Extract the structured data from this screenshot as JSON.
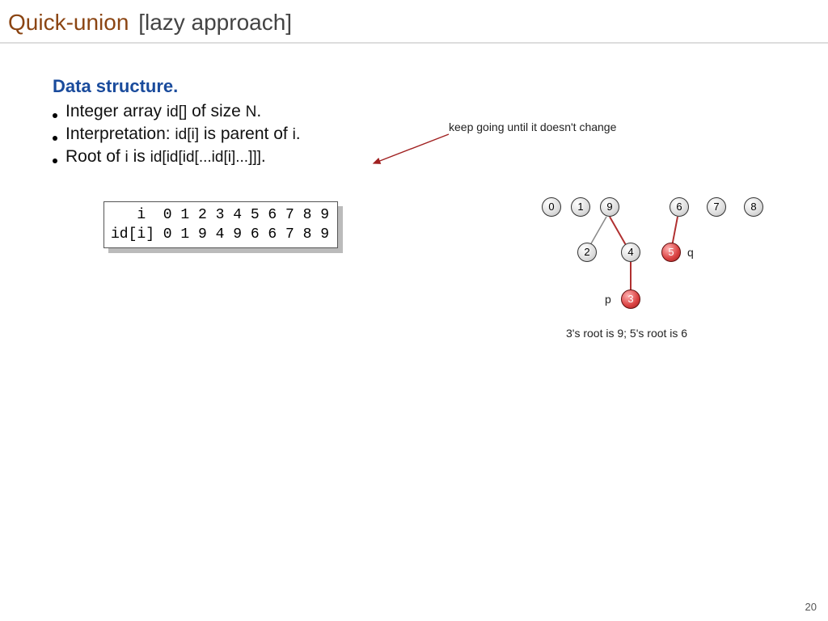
{
  "title": {
    "main": "Quick-union",
    "sub": "[lazy approach]"
  },
  "heading": "Data structure.",
  "bullets": [
    {
      "pre": "Integer array ",
      "code": "id[]",
      "mid": " of size ",
      "code2": "N",
      "post": "."
    },
    {
      "pre": "Interpretation:  ",
      "code": "id[i]",
      "mid": " is parent of ",
      "code2": "i",
      "post": "."
    },
    {
      "pre": "Root of ",
      "code": "i",
      "mid": " is ",
      "code2": "id[id[id[...id[i]...]]]",
      "post": "."
    }
  ],
  "keep_note": "keep going until it doesn't change",
  "array": {
    "row1": "   i  0 1 2 3 4 5 6 7 8 9",
    "row2": "id[i] 0 1 9 4 9 6 6 7 8 9"
  },
  "nodes": {
    "n0": "0",
    "n1": "1",
    "n2": "2",
    "n3": "3",
    "n4": "4",
    "n5": "5",
    "n6": "6",
    "n7": "7",
    "n8": "8",
    "n9": "9"
  },
  "labels": {
    "p": "p",
    "q": "q"
  },
  "caption": "3's root is 9; 5's root is 6",
  "pagenum": "20",
  "chart_data": {
    "type": "table",
    "title": "Quick-union id[] array and forest",
    "columns": [
      "i",
      "id[i]"
    ],
    "rows": [
      [
        0,
        0
      ],
      [
        1,
        1
      ],
      [
        2,
        9
      ],
      [
        3,
        4
      ],
      [
        4,
        9
      ],
      [
        5,
        6
      ],
      [
        6,
        6
      ],
      [
        7,
        7
      ],
      [
        8,
        8
      ],
      [
        9,
        9
      ]
    ],
    "forest_edges": [
      {
        "child": 2,
        "parent": 9,
        "highlight": false
      },
      {
        "child": 4,
        "parent": 9,
        "highlight": true
      },
      {
        "child": 3,
        "parent": 4,
        "highlight": true
      },
      {
        "child": 5,
        "parent": 6,
        "highlight": true
      }
    ],
    "roots": [
      0,
      1,
      9,
      6,
      7,
      8
    ],
    "highlighted_nodes": [
      3,
      5
    ],
    "annotations": {
      "p": 3,
      "q": 5
    },
    "note": "3's root is 9; 5's root is 6"
  }
}
